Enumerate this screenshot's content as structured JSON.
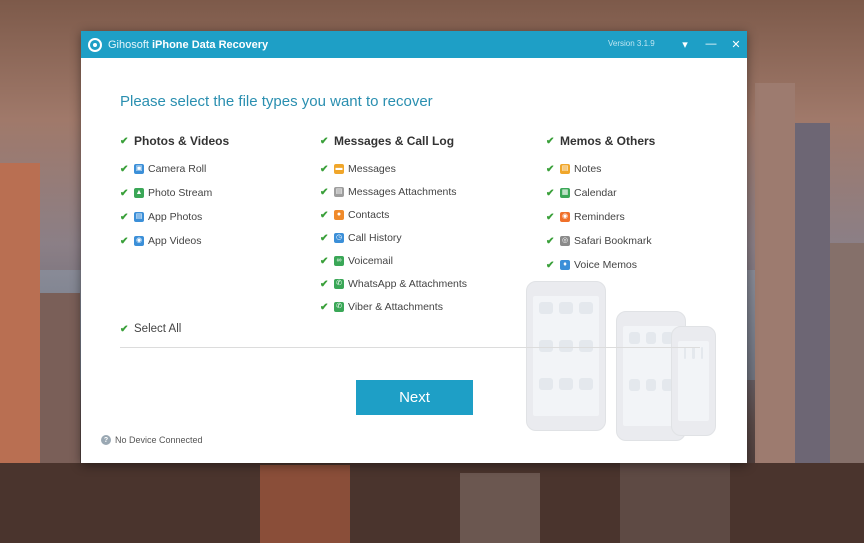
{
  "window": {
    "brand": "Gihosoft",
    "app_name": "iPhone Data Recovery",
    "version": "Version 3.1.9",
    "dropdown_glyph": "▾",
    "minimize_glyph": "—",
    "close_glyph": "✕"
  },
  "heading": "Please select the file types you want to recover",
  "check_glyph": "✔",
  "columns": [
    {
      "title": "Photos & Videos",
      "items": [
        {
          "label": "Camera Roll",
          "icon": "camera-icon",
          "color": "#3b8fd8"
        },
        {
          "label": "Photo Stream",
          "icon": "photo-stream-icon",
          "color": "#3aa757"
        },
        {
          "label": "App Photos",
          "icon": "app-photos-icon",
          "color": "#3b8fd8"
        },
        {
          "label": "App Videos",
          "icon": "app-videos-icon",
          "color": "#3b8fd8"
        }
      ]
    },
    {
      "title": "Messages & Call Log",
      "items": [
        {
          "label": "Messages",
          "icon": "messages-icon",
          "color": "#f0a62a"
        },
        {
          "label": "Messages Attachments",
          "icon": "attachments-icon",
          "color": "#9e9e9e"
        },
        {
          "label": "Contacts",
          "icon": "contacts-icon",
          "color": "#f08a2a"
        },
        {
          "label": "Call History",
          "icon": "call-history-icon",
          "color": "#3b8fd8"
        },
        {
          "label": "Voicemail",
          "icon": "voicemail-icon",
          "color": "#3aa757"
        },
        {
          "label": "WhatsApp & Attachments",
          "icon": "whatsapp-icon",
          "color": "#3aa757"
        },
        {
          "label": "Viber & Attachments",
          "icon": "viber-icon",
          "color": "#3aa757"
        }
      ]
    },
    {
      "title": "Memos & Others",
      "items": [
        {
          "label": "Notes",
          "icon": "notes-icon",
          "color": "#f0a62a"
        },
        {
          "label": "Calendar",
          "icon": "calendar-icon",
          "color": "#3aa757"
        },
        {
          "label": "Reminders",
          "icon": "reminders-icon",
          "color": "#f0702a"
        },
        {
          "label": "Safari Bookmark",
          "icon": "safari-bookmark-icon",
          "color": "#8a8a8a"
        },
        {
          "label": "Voice Memos",
          "icon": "voice-memos-icon",
          "color": "#3b8fd8"
        }
      ]
    }
  ],
  "select_all": "Select All",
  "next_label": "Next",
  "status": "No Device Connected",
  "status_icon_glyph": "?"
}
